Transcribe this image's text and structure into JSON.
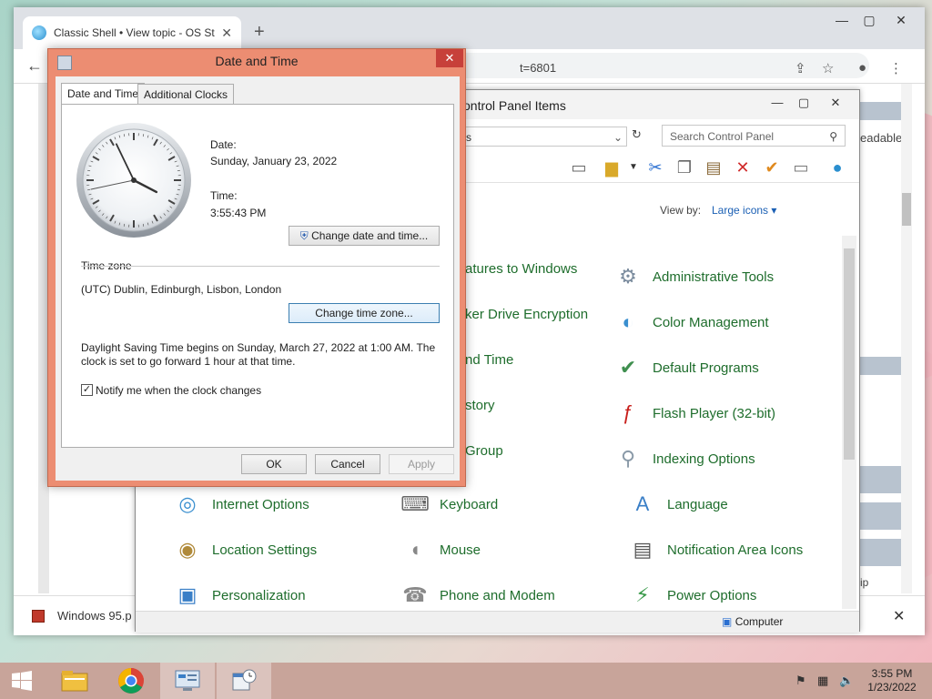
{
  "browser": {
    "tab_title": "Classic Shell • View topic - OS St",
    "url_fragment": "t=6801",
    "side_text": "eadable",
    "side_text_2": "ip",
    "download_file": "Windows 95.p"
  },
  "control_panel": {
    "title": "ontrol Panel Items",
    "address": "s",
    "search_placeholder": "Search Control Panel",
    "view_by_label": "View by:",
    "view_by_value": "Large icons ▾",
    "status_text": "Computer",
    "items": [
      {
        "label": "atures to Windows",
        "icon": "windows-features-icon"
      },
      {
        "label": "Administrative Tools",
        "icon": "admin-tools-icon"
      },
      {
        "label": "ker Drive Encryption",
        "icon": "bitlocker-icon"
      },
      {
        "label": "Color Management",
        "icon": "color-management-icon"
      },
      {
        "label": "nd Time",
        "icon": "date-time-icon"
      },
      {
        "label": "Default Programs",
        "icon": "default-programs-icon"
      },
      {
        "label": "story",
        "icon": "file-history-icon"
      },
      {
        "label": "Flash Player (32-bit)",
        "icon": "flash-icon"
      },
      {
        "label": "Group",
        "icon": "homegroup-icon"
      },
      {
        "label": "Indexing Options",
        "icon": "indexing-icon"
      },
      {
        "label": "Internet Options",
        "icon": "internet-options-icon"
      },
      {
        "label": "Keyboard",
        "icon": "keyboard-icon"
      },
      {
        "label": "Language",
        "icon": "language-icon"
      },
      {
        "label": "Location Settings",
        "icon": "location-icon"
      },
      {
        "label": "Mouse",
        "icon": "mouse-icon"
      },
      {
        "label": "Notification Area Icons",
        "icon": "notification-icon"
      },
      {
        "label": "Personalization",
        "icon": "personalization-icon"
      },
      {
        "label": "Phone and Modem",
        "icon": "phone-icon"
      },
      {
        "label": "Power Options",
        "icon": "power-icon"
      }
    ]
  },
  "dialog": {
    "title": "Date and Time",
    "tabs": [
      "Date and Time",
      "Additional Clocks"
    ],
    "date_label": "Date:",
    "date_value": "Sunday, January 23, 2022",
    "time_label": "Time:",
    "time_value": "3:55:43 PM",
    "change_datetime_btn": "Change date and time...",
    "timezone_heading": "Time zone",
    "timezone_value": "(UTC) Dublin, Edinburgh, Lisbon, London",
    "change_timezone_btn": "Change time zone...",
    "dst_line1": "Daylight Saving Time begins on Sunday, March 27, 2022 at 1:00 AM. The",
    "dst_line2": "clock is set to go forward 1 hour at that time.",
    "notify_label": "Notify me when the clock changes",
    "notify_checked": true,
    "ok": "OK",
    "cancel": "Cancel",
    "apply": "Apply",
    "clock_hour": 3,
    "clock_minute": 55,
    "clock_second": 43
  },
  "taskbar": {
    "time": "3:55 PM",
    "date": "1/23/2022",
    "apps": [
      "start-icon",
      "file-explorer-icon",
      "chrome-icon",
      "control-panel-icon",
      "date-time-taskbar-icon"
    ]
  }
}
